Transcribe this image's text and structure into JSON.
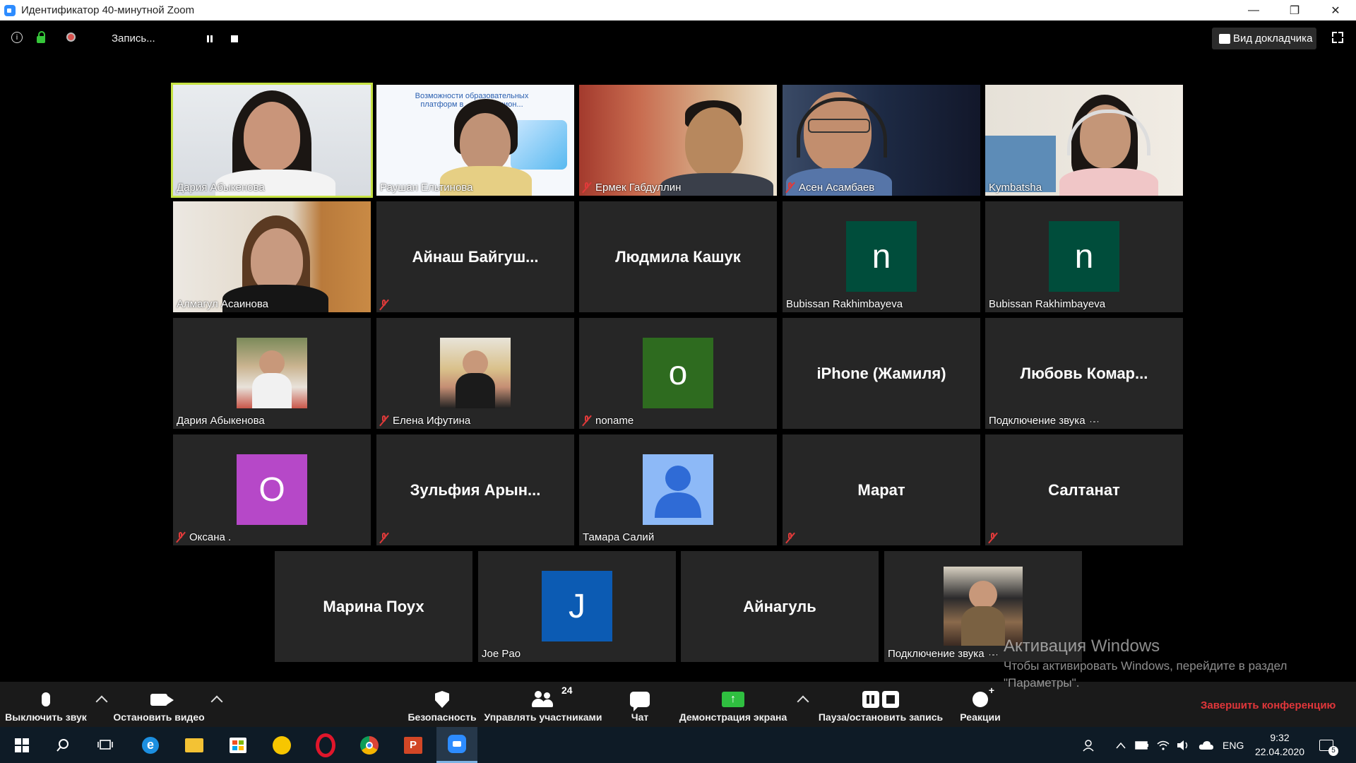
{
  "window": {
    "title": "Идентификатор 40-минутной Zoom",
    "controls": {
      "minimize": "—",
      "restore": "❐",
      "close": "✕"
    }
  },
  "topbar": {
    "recording_label": "Запись...",
    "speaker_view_label": "Вид докладчика",
    "info_glyph": "i"
  },
  "tiles": [
    {
      "name": "Дария Абыкенова",
      "muted": false,
      "kind": "video",
      "active": true
    },
    {
      "name": "Раушан Ельтинова",
      "muted": false,
      "kind": "video",
      "slide_text": "Возможности образовательных платформ в ... дистанцион..."
    },
    {
      "name": "Ермек Габдуллин",
      "muted": true,
      "kind": "video"
    },
    {
      "name": "Асен Асамбаев",
      "muted": true,
      "kind": "video"
    },
    {
      "name": "Kymbatsha",
      "muted": false,
      "kind": "video"
    },
    {
      "name": "Алмагул Асаинова",
      "muted": false,
      "kind": "video"
    },
    {
      "name": "",
      "center_name": "Айнаш  Байгуш...",
      "muted": true,
      "kind": "name"
    },
    {
      "name": "",
      "center_name": "Людмила Кашук",
      "muted": false,
      "kind": "name"
    },
    {
      "name": "Bubissan Rakhimbayeva",
      "muted": false,
      "kind": "avatar",
      "letter": "n",
      "color": "#004d3b"
    },
    {
      "name": "Bubissan Rakhimbayeva",
      "muted": false,
      "kind": "avatar",
      "letter": "n",
      "color": "#004d3b"
    },
    {
      "name": "Дария Абыкенова",
      "muted": false,
      "kind": "photo"
    },
    {
      "name": "Елена Ифутина",
      "muted": true,
      "kind": "photo"
    },
    {
      "name": "noname",
      "muted": true,
      "kind": "avatar",
      "letter": "o",
      "color": "#2e6b1f"
    },
    {
      "name": "",
      "center_name": "iPhone (Жамиля)",
      "muted": false,
      "kind": "name"
    },
    {
      "name": "Подключение звука",
      "center_name": "Любовь  Комар...",
      "muted": false,
      "kind": "name",
      "connecting": true
    },
    {
      "name": "Оксана .",
      "muted": true,
      "kind": "avatar",
      "letter": "O",
      "color": "#b648c8"
    },
    {
      "name": "",
      "center_name": "Зульфия  Арын...",
      "muted": true,
      "kind": "name"
    },
    {
      "name": "Тамара Салий",
      "muted": false,
      "kind": "person-icon",
      "color": "#8db9f7"
    },
    {
      "name": "",
      "center_name": "Марат",
      "muted": true,
      "kind": "name"
    },
    {
      "name": "",
      "center_name": "Салтанат",
      "muted": true,
      "kind": "name"
    },
    {
      "name": "",
      "center_name": "Марина Поух",
      "muted": false,
      "kind": "name"
    },
    {
      "name": "Joe Pao",
      "muted": false,
      "kind": "avatar",
      "letter": "J",
      "color": "#0c5bb3"
    },
    {
      "name": "",
      "center_name": "Айнагуль",
      "muted": false,
      "kind": "name"
    },
    {
      "name": "Подключение звука",
      "muted": false,
      "kind": "photo",
      "connecting": true
    }
  ],
  "toolbar": {
    "mute": "Выключить звук",
    "video": "Остановить видео",
    "security": "Безопасность",
    "participants": "Управлять участниками",
    "participants_count": "24",
    "chat": "Чат",
    "share": "Демонстрация экрана",
    "record": "Пауза/остановить запись",
    "reactions": "Реакции",
    "end": "Завершить конференцию"
  },
  "activation": {
    "heading": "Активация Windows",
    "line1": "Чтобы активировать Windows, перейдите в раздел",
    "line2": "\"Параметры\"."
  },
  "taskbar": {
    "lang": "ENG",
    "time": "9:32",
    "date": "22.04.2020",
    "notifications": "5"
  },
  "colors": {
    "accent_active_tile": "#c6e243",
    "end_meeting": "#e0363a",
    "share_green": "#2fbf40",
    "mute_red": "#e03a3a"
  }
}
